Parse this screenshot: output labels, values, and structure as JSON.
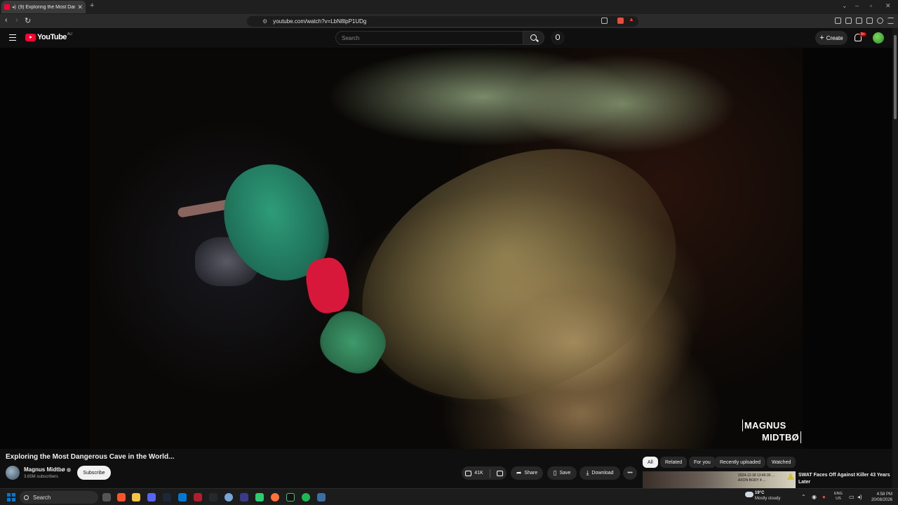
{
  "browser": {
    "tab_title": "(9) Exploring the Most Dange",
    "url": "youtube.com/watch?v=LbN8lpP1UDg"
  },
  "header": {
    "logo_text": "YouTube",
    "country_code": "AU",
    "search_placeholder": "Search",
    "create_label": "Create",
    "notifications_badge": "9+"
  },
  "video": {
    "title": "Exploring the Most Dangerous Cave in the World...",
    "watermark_line1": "MAGNUS",
    "watermark_line2": "MIDTBØ"
  },
  "channel": {
    "name": "Magnus Midtbø",
    "subscribers": "3.65M subscribers",
    "subscribe_label": "Subscribe"
  },
  "actions": {
    "likes": "41K",
    "share": "Share",
    "save": "Save",
    "download": "Download",
    "more": "•••"
  },
  "chips": [
    "All",
    "Related",
    "For you",
    "Recently uploaded",
    "Watched"
  ],
  "recommendation": {
    "title": "SWAT Faces Off Against Killer 43 Years Later",
    "thumb_timestamp": "2024-12-18 13:46:30 ...",
    "thumb_caption": "AXON BODY 4 ..."
  },
  "taskbar": {
    "search_label": "Search",
    "weather_temp": "19°C",
    "weather_desc": "Mostly cloudy",
    "lang_line1": "ENG",
    "lang_line2": "US",
    "time": "4:58 PM",
    "date": "20/08/2026"
  },
  "colors": {
    "youtube_red": "#ff0033",
    "background": "#0f0f0f",
    "climber_jacket": "#2e9c79",
    "climber_red": "#d8183a"
  }
}
